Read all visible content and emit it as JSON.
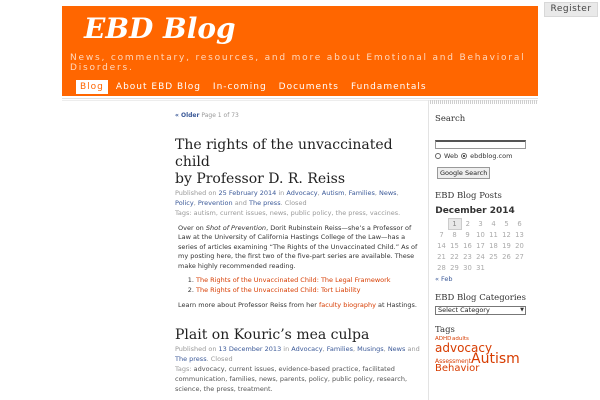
{
  "register_label": "Register",
  "blog_title": "EBD Blog",
  "tagline": "News, commentary, resources, and more about Emotional and Behavioral Disorders.",
  "nav": [
    {
      "label": "Blog",
      "active": true
    },
    {
      "label": "About EBD Blog"
    },
    {
      "label": "In-coming"
    },
    {
      "label": "Documents"
    },
    {
      "label": "Fundamentals"
    }
  ],
  "pager": {
    "older": "« Older",
    "page": "Page 1 of 73"
  },
  "posts": [
    {
      "title_line1": "The rights of the unvaccinated child",
      "title_line2": "by Professor D. R. Reiss",
      "published_prefix": "Published on",
      "date": "25 February 2014",
      "in_word": "in",
      "categories": [
        "Advocacy",
        "Autism",
        "Families",
        "News",
        "Policy",
        "Prevention"
      ],
      "and_word": "and",
      "last_category": "The press",
      "status": "Closed",
      "tags_label": "Tags:",
      "tags": "autism, current issues, news, public policy, the press, vaccines.",
      "para1_a": "Over on ",
      "para1_em": "Shot of Prevention",
      "para1_b": ", Dorit Rubinstein Reiss—she’s a Professor of Law at the University of California Hastings College of the Law—has a series of articles examining “The Rights of the Unvaccinated Child.” As of my posting here, the first two of the five-part series are available. These make highly recommended reading.",
      "links": [
        "The Rights of the Unvaccinated Child: The Legal Framework",
        "The Rights of the Unvaccinated Child: Tort Liability"
      ],
      "para2_a": "Learn more about Professor Reiss from her ",
      "para2_link": "faculty biography",
      "para2_b": " at Hastings."
    },
    {
      "title": "Plait on Kouric’s mea culpa",
      "published_prefix": "Published on",
      "date": "13 December 2013",
      "in_word": "in",
      "categories": [
        "Advocacy",
        "Families",
        "Musings",
        "News"
      ],
      "and_word": "and",
      "last_category": "The press",
      "status": "Closed",
      "tags_label": "Tags:",
      "tags": "advocacy, current issues, evidence-based practice, facilitated communication, families, news, parents, policy, public policy, research, science, the press, treatment."
    }
  ],
  "sidebar": {
    "search_heading": "Search",
    "search_value": "",
    "radio_web": "Web",
    "radio_site": "ebdblog.com",
    "search_button": "Google Search",
    "posts_heading": "EBD Blog Posts",
    "calendar_month": "December 2014",
    "calendar_weeks": [
      [
        "",
        "1",
        "2",
        "3",
        "4",
        "5",
        "6"
      ],
      [
        "7",
        "8",
        "9",
        "10",
        "11",
        "12",
        "13"
      ],
      [
        "14",
        "15",
        "16",
        "17",
        "18",
        "19",
        "20"
      ],
      [
        "21",
        "22",
        "23",
        "24",
        "25",
        "26",
        "27"
      ],
      [
        "28",
        "29",
        "30",
        "31",
        "",
        "",
        ""
      ]
    ],
    "calendar_today": "1",
    "calendar_prev": "« Feb",
    "categories_heading": "EBD Blog Categories",
    "categories_select": "Select Category",
    "tags_heading": "Tags",
    "tag_cloud": [
      "ADHD",
      "adults",
      "advocacy",
      "Assessment",
      "Autism",
      "Behavior"
    ]
  },
  "colors": {
    "header": "#ff6600",
    "link": "#3b5998",
    "accent": "#d73c00"
  }
}
